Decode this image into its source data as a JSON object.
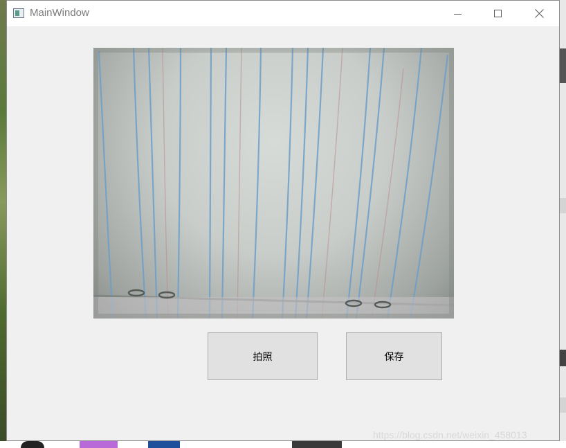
{
  "window": {
    "title": "MainWindow",
    "controls": {
      "minimize_icon": "minimize-icon",
      "maximize_icon": "maximize-icon",
      "close_icon": "close-icon"
    }
  },
  "camera": {
    "content": "notebook-paper-camera-feed"
  },
  "buttons": {
    "capture_label": "拍照",
    "save_label": "保存"
  },
  "watermark": "https://blog.csdn.net/weixin_458013",
  "colors": {
    "window_bg": "#f0f0f0",
    "button_bg": "#e1e1e1",
    "button_border": "#adadad"
  }
}
